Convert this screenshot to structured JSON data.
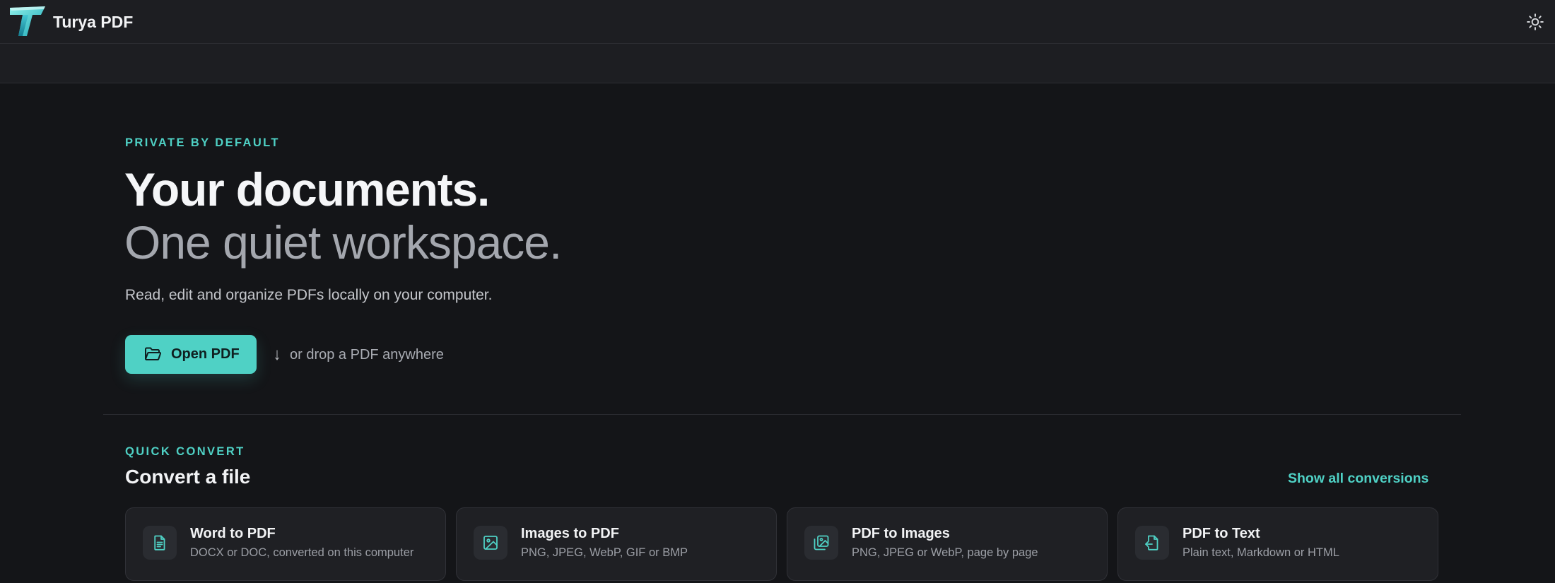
{
  "app": {
    "title": "Turya PDF",
    "logo_icon": "turya-t-logo",
    "theme_toggle_icon": "sun-icon"
  },
  "hero": {
    "eyebrow": "PRIVATE BY DEFAULT",
    "headline_1": "Your documents.",
    "headline_2": "One quiet workspace.",
    "subtitle": "Read, edit and organize PDFs locally on your computer.",
    "open_button": {
      "label": "Open PDF",
      "icon": "folder-open-icon"
    },
    "drop_hint": {
      "arrow": "↓",
      "text": "or drop a PDF anywhere"
    }
  },
  "quick_convert": {
    "eyebrow": "QUICK CONVERT",
    "title": "Convert a file",
    "show_all_label": "Show all conversions",
    "cards": [
      {
        "title": "Word to PDF",
        "description": "DOCX or DOC, converted on this computer",
        "icon": "document-icon"
      },
      {
        "title": "Images to PDF",
        "description": "PNG, JPEG, WebP, GIF or BMP",
        "icon": "image-icon"
      },
      {
        "title": "PDF to Images",
        "description": "PNG, JPEG or WebP, page by page",
        "icon": "images-stack-icon"
      },
      {
        "title": "PDF to Text",
        "description": "Plain text, Markdown or HTML",
        "icon": "file-export-icon"
      }
    ]
  },
  "colors": {
    "accent": "#4fd1c5",
    "background": "#141518",
    "topbar": "#1d1e22",
    "card": "#1f2024"
  }
}
